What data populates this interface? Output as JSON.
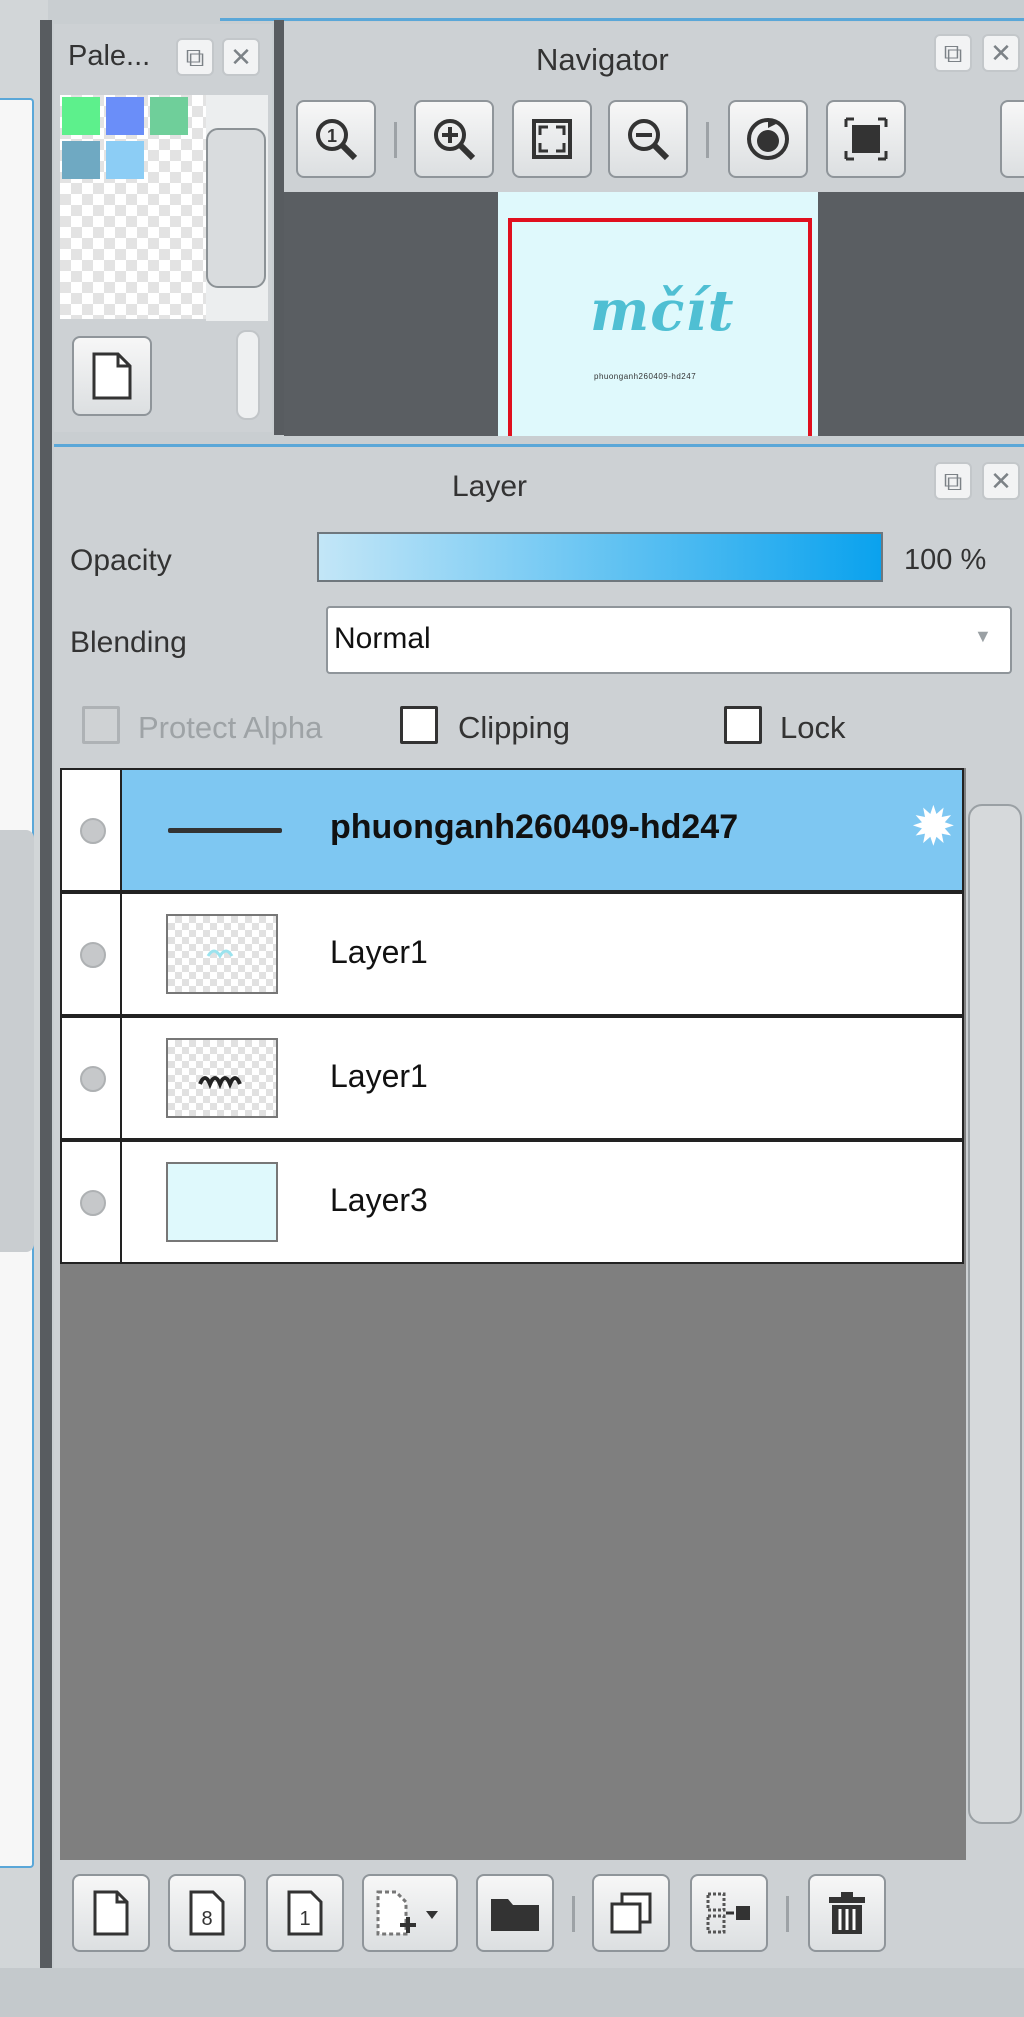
{
  "palette": {
    "title": "Pale...",
    "swatches": [
      "#5df08c",
      "#6a8ef9",
      "#6fcf9a",
      "#6fa9c2",
      "#8ccdf5"
    ]
  },
  "navigator": {
    "title": "Navigator",
    "tools": [
      "zoom-reset-icon",
      "zoom-in-icon",
      "fit-screen-icon",
      "zoom-out-icon",
      "rotate-icon",
      "flip-icon"
    ],
    "canvas_text": "mčít"
  },
  "layer_panel": {
    "title": "Layer",
    "opacity_label": "Opacity",
    "opacity_value": "100 %",
    "opacity_fraction": 1.0,
    "blending_label": "Blending",
    "blending_value": "Normal",
    "protect_alpha_label": "Protect Alpha",
    "clipping_label": "Clipping",
    "lock_label": "Lock",
    "layers": [
      {
        "name": "phuonganh260409-hd247",
        "selected": true,
        "type": "text"
      },
      {
        "name": "Layer1",
        "selected": false,
        "type": "raster"
      },
      {
        "name": "Layer1",
        "selected": false,
        "type": "raster"
      },
      {
        "name": "Layer3",
        "selected": false,
        "type": "fill"
      }
    ],
    "footer_tools": [
      "new-layer-icon",
      "new-8bit-layer-icon",
      "new-1bit-layer-icon",
      "add-layer-dropdown-icon",
      "folder-icon",
      "duplicate-layer-icon",
      "merge-down-icon",
      "delete-layer-icon"
    ]
  },
  "colors": {
    "accent": "#5aa7d8",
    "selected_row": "#7ec7f2",
    "frame_red": "#e0101e",
    "canvas_bg": "#dff9fc"
  }
}
